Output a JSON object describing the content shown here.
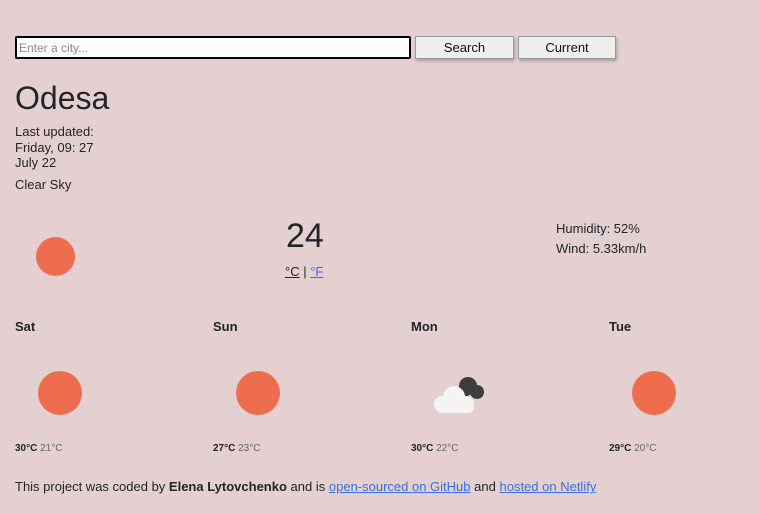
{
  "search": {
    "placeholder": "Enter a city...",
    "search_label": "Search",
    "current_label": "Current"
  },
  "city": "Odesa",
  "updated": {
    "label": "Last updated:",
    "day_time": "Friday, 09: 27",
    "date": "July 22"
  },
  "description": "Clear Sky",
  "current": {
    "icon": "sun-icon",
    "temperature": "24",
    "unit_c": "°C",
    "separator": "|",
    "unit_f": "°F",
    "humidity": "Humidity: 52%",
    "wind": "Wind: 5.33km/h"
  },
  "forecast": [
    {
      "day": "Sat",
      "icon": "sun-icon",
      "max": "30°C",
      "min": "21°C"
    },
    {
      "day": "Sun",
      "icon": "sun-icon",
      "max": "27°C",
      "min": "23°C"
    },
    {
      "day": "Mon",
      "icon": "cloud-icon",
      "max": "30°C",
      "min": "22°C"
    },
    {
      "day": "Tue",
      "icon": "sun-icon",
      "max": "29°C",
      "min": "20°C"
    }
  ],
  "footer": {
    "prefix": "This project was coded by",
    "author": "Elena Lytovchenko",
    "middle": "and is",
    "github_link": "open-sourced on GitHub",
    "and": "and",
    "netlify_link": "hosted on Netlify"
  },
  "colors": {
    "background": "#e4d0d0",
    "sun": "#ee6d4f",
    "link": "#3a6ee6"
  }
}
